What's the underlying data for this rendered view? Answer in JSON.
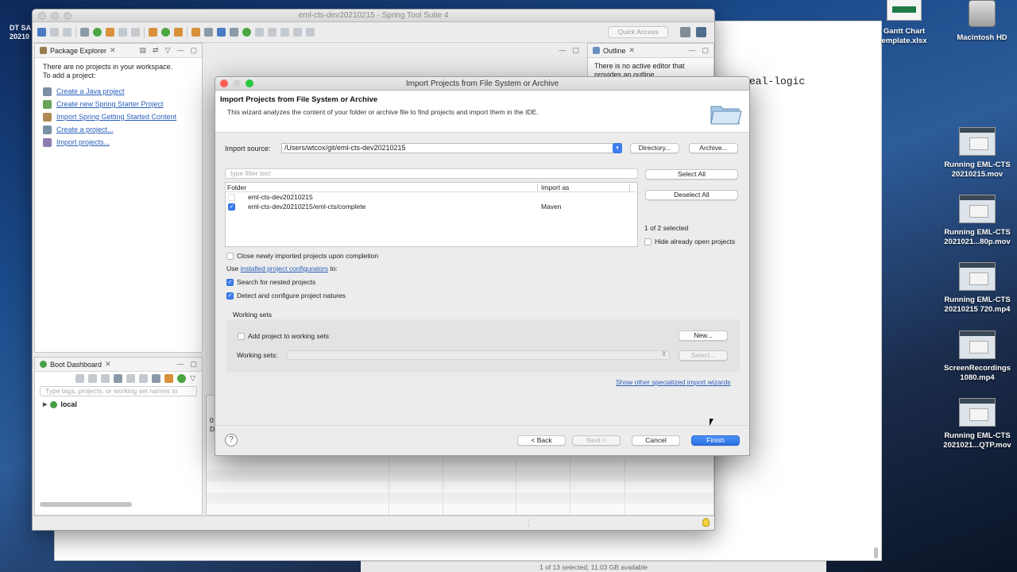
{
  "desktop": {
    "partial_left_label_1": "DT SA",
    "partial_left_label_2": "20210",
    "icons": [
      {
        "label": "Gantt Chart\nemplate.xlsx"
      },
      {
        "label": "Macintosh HD"
      },
      {
        "label": "Running EML-CTS\n20210215.mov"
      },
      {
        "label": "Running EML-CTS\n2021021...80p.mov"
      },
      {
        "label": "Running EML-CTS\n20210215 720.mp4"
      },
      {
        "label": "ScreenRecordings\n1080.mp4"
      },
      {
        "label": "Running EML-CTS\n2021021...QTP.mov"
      }
    ],
    "back_editor_text": "eal-logic",
    "finder_status": "1 of 13 selected, 11.03 GB available"
  },
  "ide": {
    "window_title": "eml-cts-dev20210215 - Spring Tool Suite 4",
    "quick_access_placeholder": "Quick Access",
    "package_explorer": {
      "tab_label": "Package Explorer",
      "message_line1": "There are no projects in your workspace.",
      "message_line2": "To add a project:",
      "links": [
        "Create a Java project",
        "Create new Spring Starter Project",
        "Import Spring Getting Started Content",
        "Create a project...",
        "Import projects..."
      ]
    },
    "outline": {
      "tab_label": "Outline",
      "message_line1": "There is no active editor that",
      "message_line2": "provides an outline."
    },
    "boot_dashboard": {
      "tab_label": "Boot Dashboard",
      "filter_placeholder": "Type tags, projects, or working set names to",
      "tree_item": "local"
    },
    "console_partial_1": "0",
    "console_partial_2": "De"
  },
  "dialog": {
    "title": "Import Projects from File System or Archive",
    "heading": "Import Projects from File System or Archive",
    "description": "This wizard analyzes the content of your folder or archive file to find projects and import them in the IDE.",
    "import_source_label": "Import source:",
    "import_source_value": "/Users/wtcox/git/eml-cts-dev20210215",
    "directory_button": "Directory...",
    "archive_button": "Archive...",
    "filter_placeholder": "type filter text",
    "select_all_button": "Select All",
    "deselect_all_button": "Deselect All",
    "table": {
      "columns": [
        "Folder",
        "Import as"
      ],
      "rows": [
        {
          "folder": "eml-cts-dev20210215",
          "import_as": "",
          "checked": false
        },
        {
          "folder": "eml-cts-dev20210215/eml-cts/complete",
          "import_as": "Maven",
          "checked": true
        }
      ]
    },
    "selection_count": "1 of 2 selected",
    "hide_open_projects_label": "Hide already open projects",
    "close_projects_label": "Close newly imported projects upon completion",
    "use_prefix": "Use",
    "configurators_link": "installed project configurators",
    "use_suffix": "to:",
    "search_nested_label": "Search for nested projects",
    "detect_natures_label": "Detect and configure project natures",
    "working_sets_group_label": "Working sets",
    "add_to_working_sets_label": "Add project to working sets",
    "new_button": "New...",
    "working_sets_label": "Working sets:",
    "select_button": "Select...",
    "specialized_wizards_link": "Show other specialized import wizards",
    "back_button": "< Back",
    "next_button": "Next >",
    "cancel_button": "Cancel",
    "finish_button": "Finish",
    "help_glyph": "?"
  }
}
